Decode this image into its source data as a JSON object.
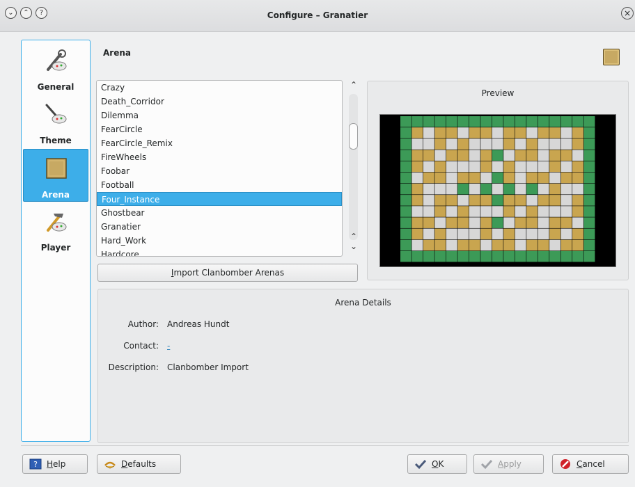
{
  "window": {
    "title": "Configure – Granatier"
  },
  "titlebar_icons": [
    "chevron-down-icon",
    "chevrons-up-icon",
    "help-icon",
    "close-icon"
  ],
  "sidebar": {
    "items": [
      {
        "label": "General",
        "icon": "general-settings-icon"
      },
      {
        "label": "Theme",
        "icon": "theme-icon"
      },
      {
        "label": "Arena",
        "icon": "arena-icon",
        "selected": true
      },
      {
        "label": "Player",
        "icon": "player-icon"
      }
    ]
  },
  "page": {
    "title": "Arena"
  },
  "arena_list": {
    "items": [
      "Crazy",
      "Death_Corridor",
      "Dilemma",
      "FearCircle",
      "FearCircle_Remix",
      "FireWheels",
      "Foobar",
      "Football",
      "Four_Instance",
      "Ghostbear",
      "Granatier",
      "Hard_Work",
      "Hardcore"
    ],
    "selected": "Four_Instance"
  },
  "import_button": {
    "prefix": "I",
    "rest": "mport Clanbomber Arenas"
  },
  "preview": {
    "title": "Preview"
  },
  "details": {
    "title": "Arena Details",
    "author_label": "Author:",
    "author": "Andreas Hundt",
    "contact_label": "Contact:",
    "contact": "-",
    "description_label": "Description:",
    "description": "Clanbomber Import"
  },
  "buttons": {
    "help": {
      "u": "H",
      "rest": "elp"
    },
    "defaults": {
      "u": "D",
      "rest": "efaults"
    },
    "ok": {
      "u": "O",
      "rest": "K"
    },
    "apply": {
      "u": "A",
      "rest": "pply"
    },
    "cancel": {
      "u": "C",
      "rest": "ancel"
    }
  },
  "colors": {
    "accent": "#3daee9",
    "grass": "#3c9a57",
    "brick": "#c9a54f",
    "stone": "#d7d7d7"
  }
}
